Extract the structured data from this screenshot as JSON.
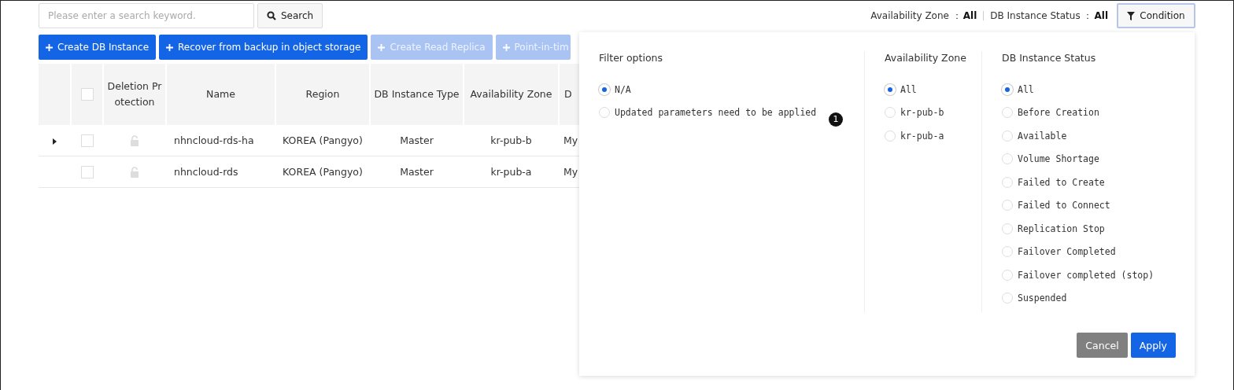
{
  "search": {
    "placeholder": "Please enter a search keyword.",
    "button": "Search"
  },
  "filter_summary": [
    {
      "label": "Availability Zone ：",
      "value": "All"
    },
    {
      "label": "DB Instance Status ：",
      "value": "All"
    }
  ],
  "condition_button": "Condition",
  "toolbar": [
    {
      "label": "Create DB Instance",
      "disabled": false
    },
    {
      "label": "Recover from backup in object storage",
      "disabled": false
    },
    {
      "label": "Create Read Replica",
      "disabled": true
    },
    {
      "label": "Point-in-tim",
      "disabled": true
    }
  ],
  "table": {
    "select_all": {
      "checked": false
    },
    "columns": [
      "Deletion Protection",
      "Name",
      "Region",
      "DB Instance Type",
      "Availability Zone",
      "D"
    ],
    "rows": [
      {
        "expandable": true,
        "checked": false,
        "deletion_protection": false,
        "name": "nhncloud-rds-ha",
        "region": "KOREA (Pangyo)",
        "type": "Master",
        "zone": "kr-pub-b",
        "column_6": "My"
      },
      {
        "expandable": false,
        "checked": false,
        "deletion_protection": false,
        "name": "nhncloud-rds",
        "region": "KOREA (Pangyo)",
        "type": "Master",
        "zone": "kr-pub-a",
        "column_6": "My"
      }
    ]
  },
  "filter_panel": {
    "groups": [
      {
        "title": "Filter options",
        "options": [
          {
            "label": "N/A",
            "selected": true
          },
          {
            "label": "Updated parameters need to be applied",
            "selected": false
          }
        ]
      },
      {
        "title": "Availability Zone",
        "options": [
          {
            "label": "All",
            "selected": true
          },
          {
            "label": "kr-pub-b",
            "selected": false
          },
          {
            "label": "kr-pub-a",
            "selected": false
          }
        ]
      },
      {
        "title": "DB Instance Status",
        "options": [
          {
            "label": "All",
            "selected": true
          },
          {
            "label": "Before Creation",
            "selected": false
          },
          {
            "label": "Available",
            "selected": false
          },
          {
            "label": "Volume Shortage",
            "selected": false
          },
          {
            "label": "Failed to Create",
            "selected": false
          },
          {
            "label": "Failed to Connect",
            "selected": false
          },
          {
            "label": "Replication Stop",
            "selected": false
          },
          {
            "label": "Failover Completed",
            "selected": false
          },
          {
            "label": "Failover completed (stop)",
            "selected": false
          },
          {
            "label": "Suspended",
            "selected": false
          }
        ]
      }
    ],
    "marker": "1",
    "buttons": [
      {
        "label": "Cancel",
        "kind": "secondary"
      },
      {
        "label": "Apply",
        "kind": "primary"
      }
    ]
  }
}
